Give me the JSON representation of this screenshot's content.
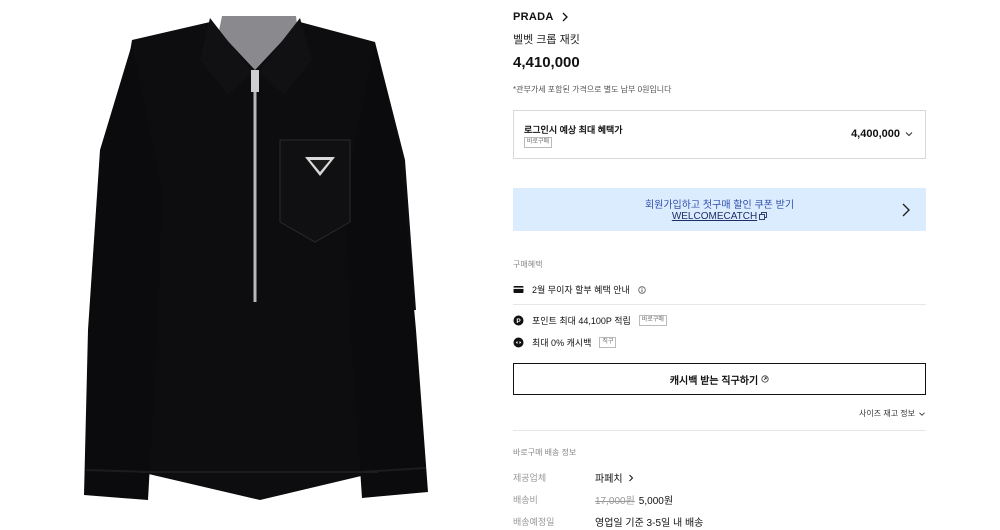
{
  "product": {
    "brand": "PRADA",
    "name": "벨벳 크롭 재킷",
    "price": "4,410,000",
    "tax_note": "*관부가세 포함된 가격으로 별도 납부 0원입니다",
    "image_alt": "black velvet cropped jacket with zipper and triangle logo pocket"
  },
  "benefit": {
    "title": "로그인시 예상 최대 혜택가",
    "tag": "바로구매",
    "price": "4,400,000"
  },
  "coupon": {
    "text": "회원가입하고 첫구매 할인 쿠폰 받기",
    "code": "WELCOMECATCH"
  },
  "purchase_benefits": {
    "label": "구매혜택",
    "installment": "2월 무이자 할부 혜택 안내",
    "points": "포인트 최대 44,100P 적립",
    "points_tag": "바로구매",
    "cashback": "최대 0% 캐시백",
    "cashback_tag": "직구"
  },
  "buy_button": {
    "label": "캐시백 받는 직구하기"
  },
  "size_link": {
    "label": "사이즈 재고 정보"
  },
  "shipping": {
    "section_label": "바로구매 배송 정보",
    "provider_label": "제공업체",
    "provider_value": "파페치",
    "fee_label": "배송비",
    "fee_original": "17,000원",
    "fee_value": "5,000원",
    "eta_label": "배송예정일",
    "eta_value": "영업일 기준 3-5일 내 배송"
  },
  "colors": {
    "coupon_bg": "#dcecff",
    "coupon_text": "#2f4fa8",
    "jacket": "#0d0d0f"
  }
}
